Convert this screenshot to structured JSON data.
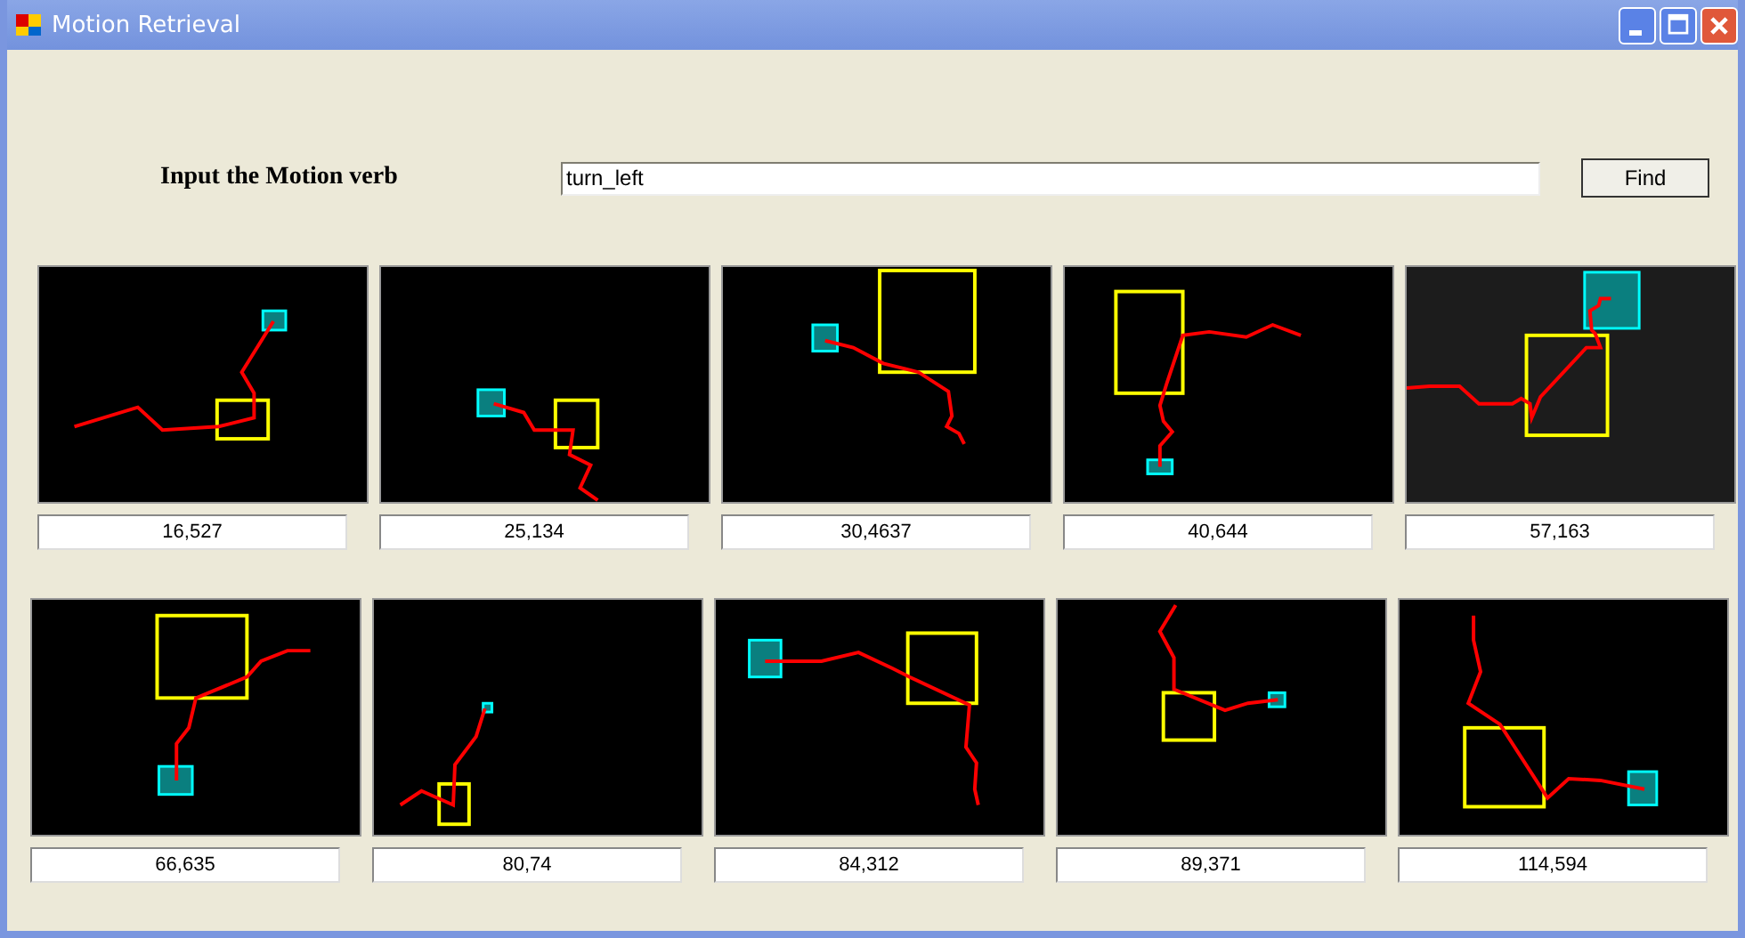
{
  "window": {
    "title": "Motion Retrieval"
  },
  "query": {
    "label": "Input the Motion verb",
    "value": "turn_left",
    "button": "Find"
  },
  "result_rows": [
    {
      "results": [
        {
          "score": "16,527"
        },
        {
          "score": "25,134"
        },
        {
          "score": "30,4637"
        },
        {
          "score": "40,644"
        },
        {
          "score": "57,163"
        }
      ]
    },
    {
      "results": [
        {
          "score": "66,635"
        },
        {
          "score": "80,74"
        },
        {
          "score": "84,312"
        },
        {
          "score": "89,371"
        },
        {
          "score": "114,594"
        }
      ]
    }
  ]
}
